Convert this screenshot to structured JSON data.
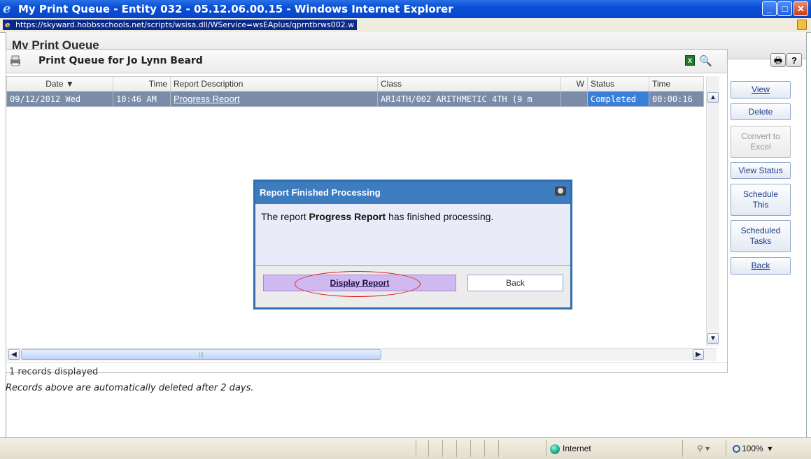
{
  "window": {
    "title": "My Print Queue - Entity 032 - 05.12.06.00.15 - Windows Internet Explorer",
    "url": "https://skyward.hobbsschools.net/scripts/wsisa.dll/WService=wsEAplus/qprntbrws002.w"
  },
  "page": {
    "title": "My Print Queue",
    "panel_title": "Print Queue for Jo Lynn Beard"
  },
  "table": {
    "headers": {
      "date": "Date ▼",
      "time": "Time",
      "description": "Report Description",
      "class": "Class",
      "w": "W",
      "status": "Status",
      "elapsed": "Time"
    },
    "rows": [
      {
        "date": "09/12/2012 Wed",
        "time": "10:46 AM",
        "description": "Progress Report",
        "class": "ARI4TH/002 ARITHMETIC 4TH (9 m",
        "w": "",
        "status": "Completed",
        "elapsed": "00:00:16"
      }
    ]
  },
  "records_displayed": "1 records displayed",
  "note": "Records above are automatically deleted after 2 days.",
  "sidebar": {
    "view": "View",
    "delete": "Delete",
    "convert": "Convert to Excel",
    "view_status": "View Status",
    "schedule": "Schedule This",
    "scheduled_tasks": "Scheduled Tasks",
    "back": "Back"
  },
  "dialog": {
    "title": "Report Finished Processing",
    "msg_prefix": "The report ",
    "msg_report": "Progress Report",
    "msg_suffix": " has finished processing.",
    "display_button": "Display Report",
    "back_button": "Back"
  },
  "statusbar": {
    "zone": "Internet",
    "zoom": "100%"
  }
}
